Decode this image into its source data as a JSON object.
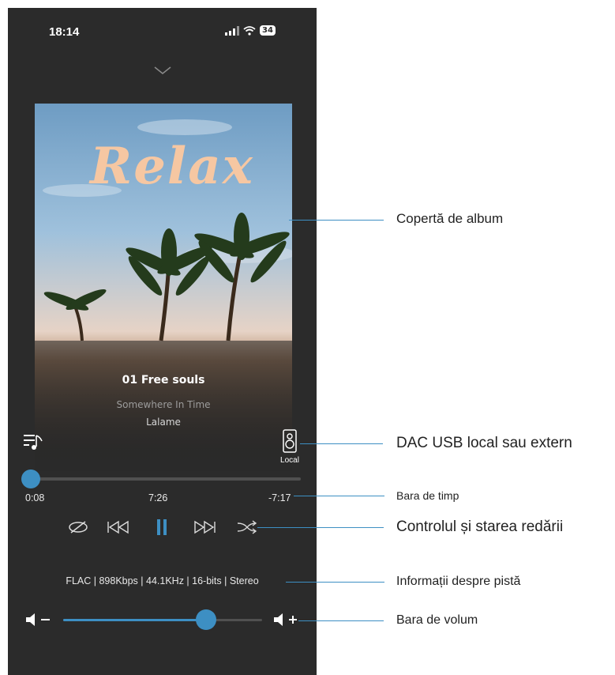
{
  "status_bar": {
    "time": "18:14",
    "battery": "34"
  },
  "track": {
    "title": "01 Free souls",
    "album": "Somewhere In Time",
    "artist": "Lalame"
  },
  "cover": {
    "text": "Relax"
  },
  "output": {
    "label": "Local"
  },
  "timeline": {
    "elapsed": "0:08",
    "total": "7:26",
    "remaining": "-7:17",
    "progress_fraction": 0.018
  },
  "track_info": "FLAC | 898Kbps | 44.1KHz | 16-bits | Stereo",
  "volume": {
    "level_fraction": 0.72
  },
  "annotations": {
    "album_cover": "Copertă de album",
    "dac": "DAC USB local sau extern",
    "time_bar": "Bara de timp",
    "playback": "Controlul și starea redării",
    "track_info": "Informații despre pistă",
    "volume_bar": "Bara de volum"
  },
  "colors": {
    "accent": "#3d8fc3",
    "background": "#2b2b2b",
    "cover_text": "#f6c7a2"
  },
  "icons": [
    "chevron-down-icon",
    "playlist-icon",
    "speaker-icon",
    "repeat-off-icon",
    "previous-icon",
    "pause-icon",
    "next-icon",
    "shuffle-icon",
    "volume-down-icon",
    "volume-up-icon"
  ]
}
